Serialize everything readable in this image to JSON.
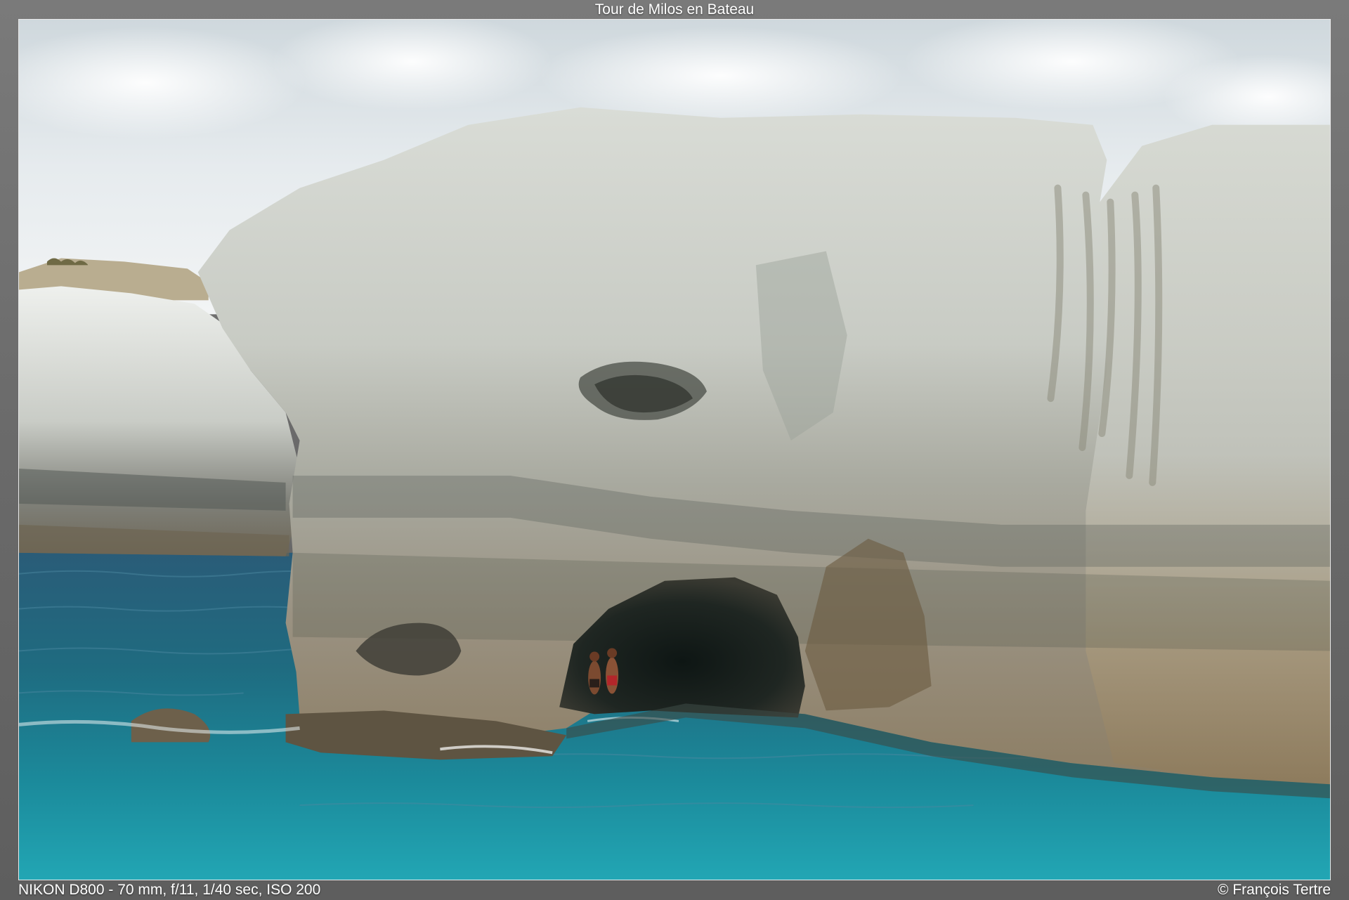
{
  "viewer": {
    "title": "Tour de Milos en Bateau",
    "exif": "NIKON D800 - 70 mm, f/11, 1/40 sec, ISO 200",
    "copyright": "© François Tertre"
  },
  "photo": {
    "subject": "white volcanic rock cliffs with sea cave above turquoise water"
  },
  "colors": {
    "background": "#6e6e6e",
    "text": "#ffffff",
    "frame_border": "#e8e8e8"
  }
}
